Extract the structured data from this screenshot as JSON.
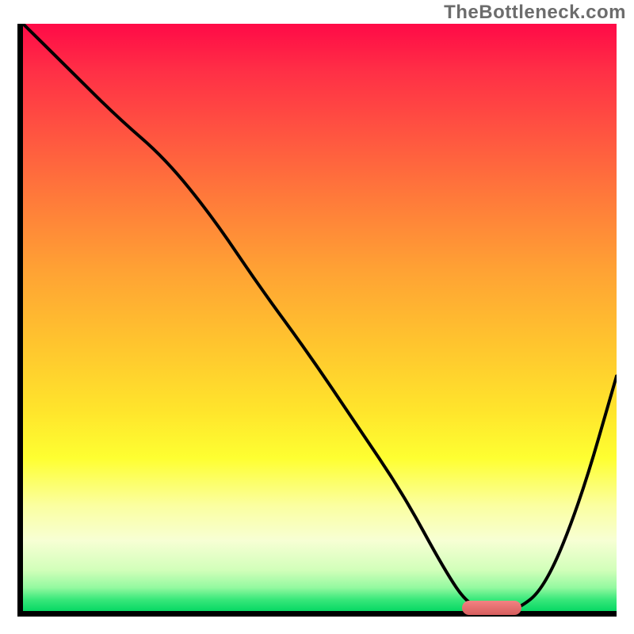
{
  "watermark": "TheBottleneck.com",
  "chart_data": {
    "type": "line",
    "title": "",
    "xlabel": "",
    "ylabel": "",
    "xlim": [
      0,
      100
    ],
    "ylim": [
      0,
      100
    ],
    "grid": false,
    "series": [
      {
        "name": "bottleneck-curve",
        "color": "#000000",
        "x": [
          0,
          8,
          16,
          24,
          32,
          40,
          48,
          56,
          64,
          71,
          75,
          79,
          83,
          88,
          94,
          100
        ],
        "y": [
          100,
          92,
          84,
          77,
          67,
          55,
          44,
          32,
          20,
          7,
          1,
          0,
          0,
          4,
          19,
          40
        ]
      }
    ],
    "annotations": [
      {
        "name": "optimal-range-bar",
        "type": "bar_segment",
        "x_start": 74,
        "x_end": 84,
        "y": 0.5,
        "color": "#e06c6c"
      }
    ],
    "background_gradient": {
      "type": "vertical",
      "stops": [
        {
          "pos": 0,
          "color": "#ff0a47"
        },
        {
          "pos": 55,
          "color": "#ffc62e"
        },
        {
          "pos": 74,
          "color": "#feff31"
        },
        {
          "pos": 96,
          "color": "#94f9a0"
        },
        {
          "pos": 100,
          "color": "#07d864"
        }
      ]
    }
  },
  "plot": {
    "inner_width": 749,
    "inner_height": 741
  }
}
